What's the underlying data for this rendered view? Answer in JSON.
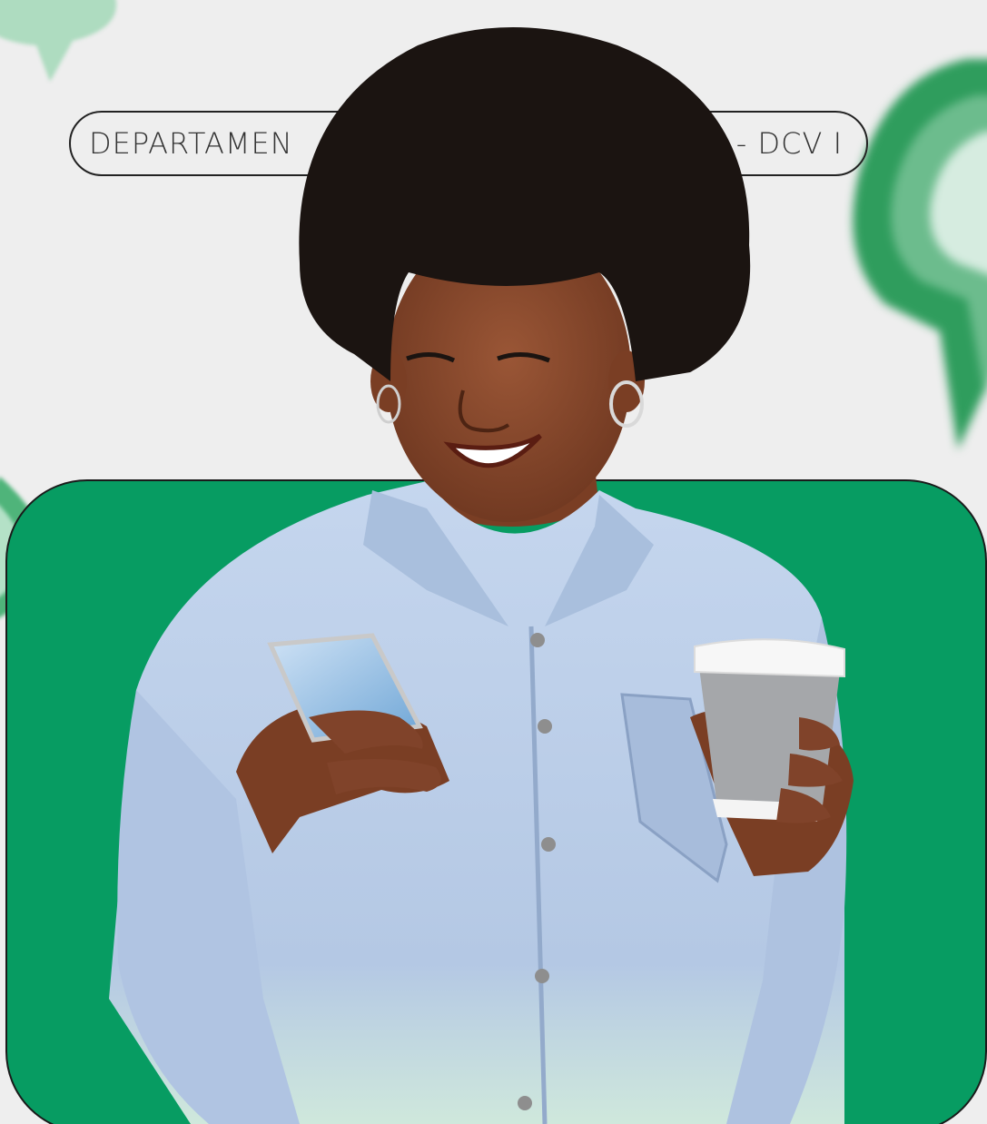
{
  "header": {
    "pill_left": "DEPARTAMEN",
    "pill_right": "- DCV I"
  },
  "colors": {
    "background": "#eeeeee",
    "panel": "#079c62",
    "bubble": "#3fae6e",
    "shirt": "#b8cbe6",
    "skin": "#8a4a2e",
    "hair": "#1b1411"
  },
  "icons": [
    "chat-bubble-icon",
    "phone-icon",
    "coffee-cup-icon"
  ]
}
